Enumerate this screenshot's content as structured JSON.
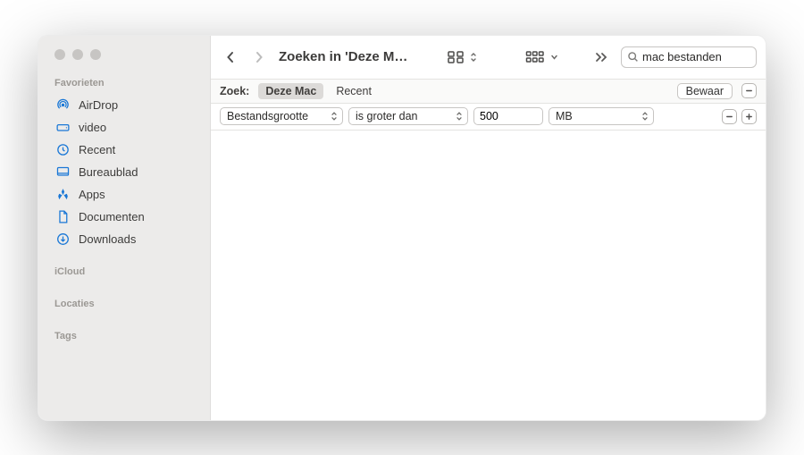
{
  "sidebar": {
    "sections": {
      "favorites": "Favorieten",
      "icloud": "iCloud",
      "locations": "Locaties",
      "tags": "Tags"
    },
    "items": [
      {
        "label": "AirDrop"
      },
      {
        "label": "video"
      },
      {
        "label": "Recent"
      },
      {
        "label": "Bureaublad"
      },
      {
        "label": "Apps"
      },
      {
        "label": "Documenten"
      },
      {
        "label": "Downloads"
      }
    ]
  },
  "toolbar": {
    "title": "Zoeken in 'Deze M…",
    "search_value": "mac bestanden"
  },
  "scope": {
    "label": "Zoek:",
    "active": "Deze Mac",
    "other": "Recent",
    "save": "Bewaar"
  },
  "criteria": {
    "attr": "Bestandsgrootte",
    "comparator": "is groter dan",
    "value": "500",
    "unit": "MB"
  }
}
